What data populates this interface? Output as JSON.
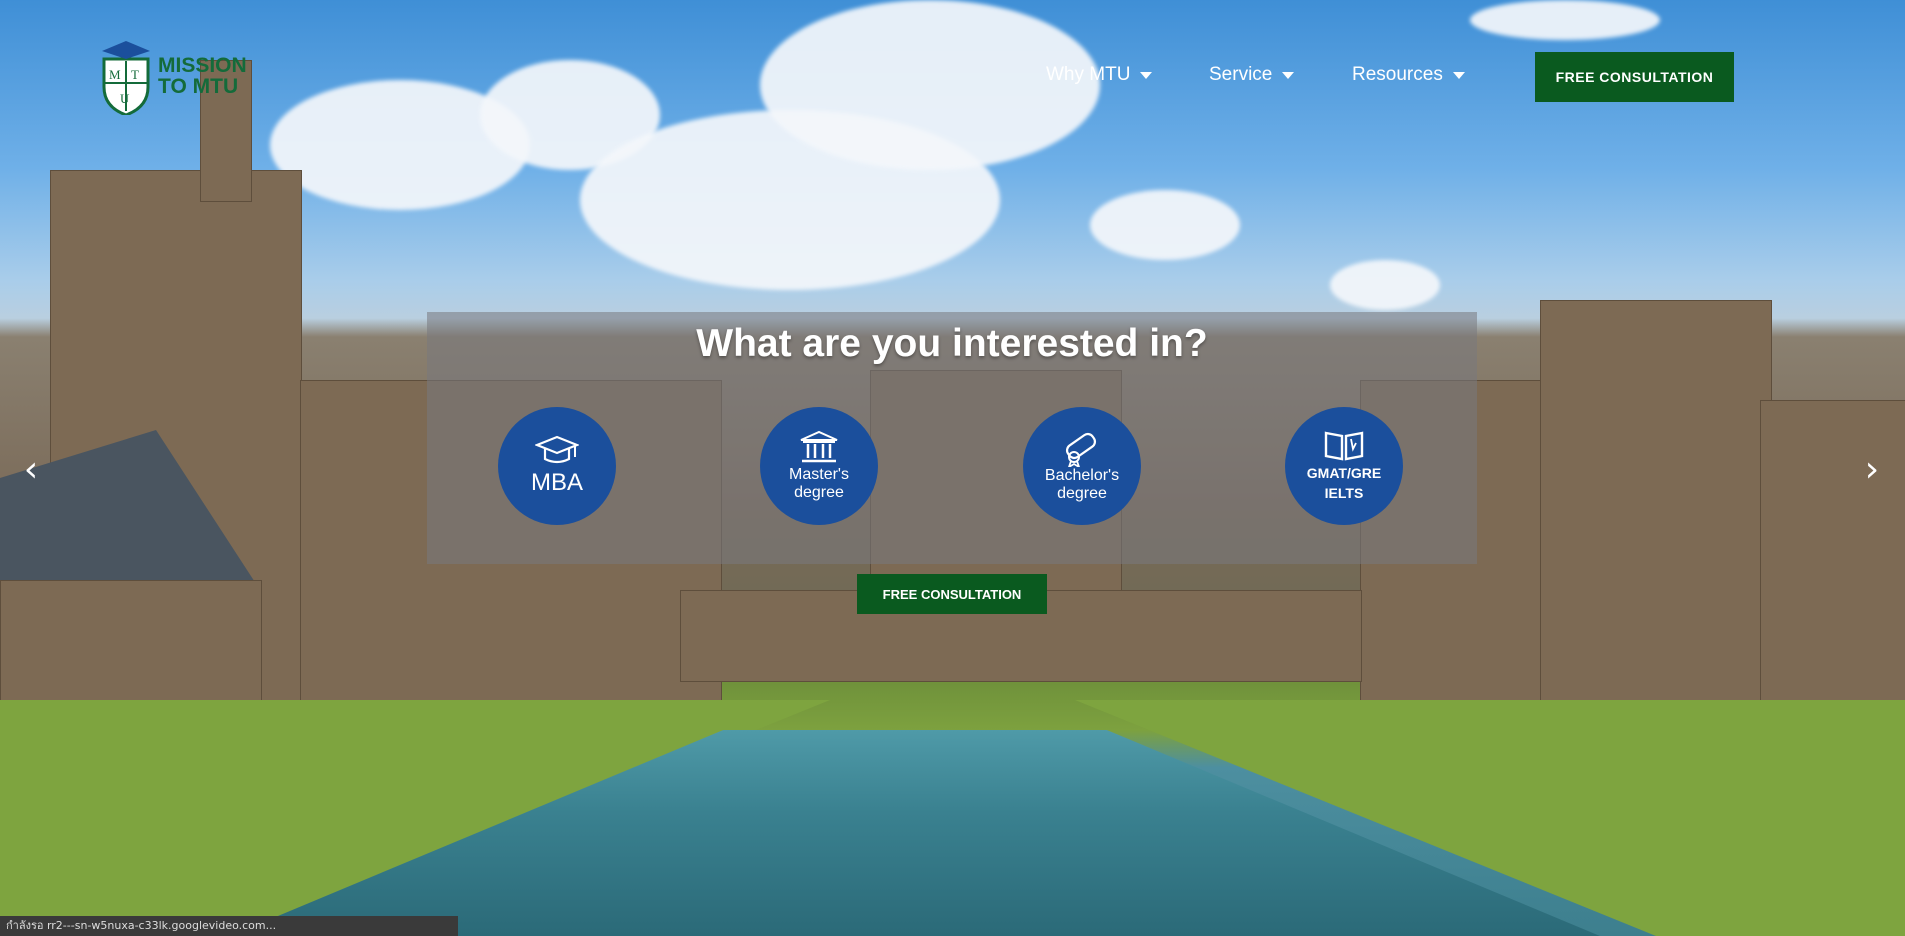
{
  "logo": {
    "text_line1": "MISSION",
    "text_line2": "TO MTU",
    "shield_letters": [
      "M",
      "T",
      "U"
    ],
    "color": "#146b3a"
  },
  "nav": [
    {
      "label": "Why MTU"
    },
    {
      "label": "Service"
    },
    {
      "label": "Resources"
    }
  ],
  "header": {
    "cta_label": "FREE CONSULTATION",
    "cta_color": "#0a5a1f"
  },
  "hero": {
    "title": "What are you interested in?",
    "options": [
      {
        "label": "MBA",
        "icon": "graduation-cap-icon"
      },
      {
        "label": "Master's degree",
        "line1": "Master's",
        "line2": "degree",
        "icon": "institution-icon"
      },
      {
        "label": "Bachelor's degree",
        "line1": "Bachelor's",
        "line2": "degree",
        "icon": "diploma-icon"
      },
      {
        "label": "GMAT/GRE IELTS",
        "line1": "GMAT/GRE",
        "line2": "IELTS",
        "icon": "open-book-icon"
      }
    ],
    "cta_label": "FREE CONSULTATION",
    "circle_color": "#1b4f9c"
  },
  "carousel": {
    "prev_icon": "chevron-left-icon",
    "next_icon": "chevron-right-icon"
  },
  "status_bar": {
    "text": "กำลังรอ rr2---sn-w5nuxa-c33lk.googlevideo.com..."
  }
}
